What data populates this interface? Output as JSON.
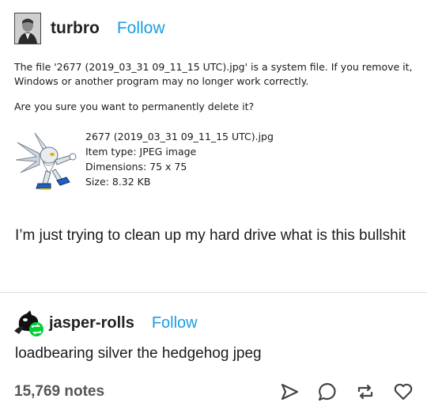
{
  "post": {
    "username": "turbro",
    "follow_label": "Follow",
    "avatar_icon": "portrait-avatar-icon"
  },
  "dialog": {
    "message": "The file '2677 (2019_03_31 09_11_15 UTC).jpg' is a system file. If you remove it, Windows or another program may no longer work correctly.",
    "question": "Are you sure you want to permanently delete it?",
    "file_name": "2677 (2019_03_31 09_11_15 UTC).jpg",
    "item_type": "Item type: JPEG image",
    "dimensions": "Dimensions: 75 x 75",
    "size": "Size: 8.32 KB",
    "thumbnail_icon": "silver-hedgehog-thumbnail"
  },
  "post_text": "I’m just trying to clean up my hard drive what is this bullshit",
  "reblog": {
    "username": "jasper-rolls",
    "follow_label": "Follow",
    "reply_text": "loadbearing silver the hedgehog jpeg"
  },
  "footer": {
    "notes": "15,769 notes",
    "icons": [
      "share-icon",
      "reply-icon",
      "reblog-icon",
      "like-icon"
    ]
  },
  "colors": {
    "follow": "#1a9de2",
    "reblog_badge": "#00cf35"
  }
}
